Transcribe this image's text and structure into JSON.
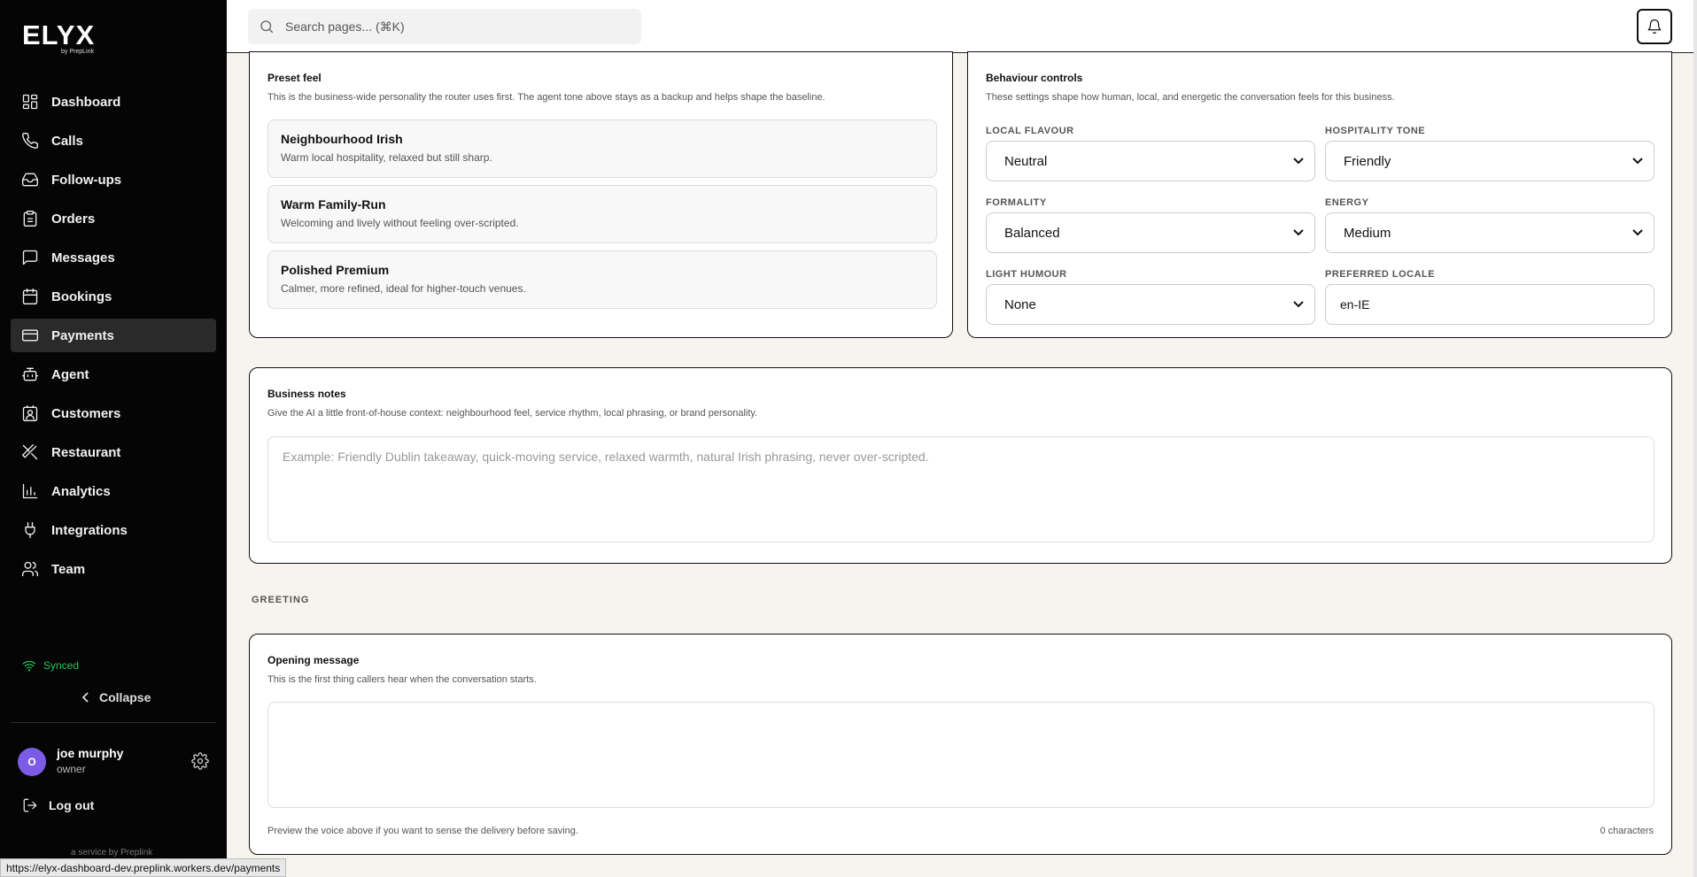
{
  "app": {
    "logo": "ELYX",
    "logo_sub": "by PrepLink"
  },
  "sidebar": {
    "items": [
      {
        "label": "Dashboard",
        "icon": "grid-icon"
      },
      {
        "label": "Calls",
        "icon": "phone-icon"
      },
      {
        "label": "Follow-ups",
        "icon": "inbox-icon"
      },
      {
        "label": "Orders",
        "icon": "clipboard-icon"
      },
      {
        "label": "Messages",
        "icon": "message-icon"
      },
      {
        "label": "Bookings",
        "icon": "calendar-icon"
      },
      {
        "label": "Payments",
        "icon": "card-icon",
        "active": true
      },
      {
        "label": "Agent",
        "icon": "bot-icon"
      },
      {
        "label": "Customers",
        "icon": "contact-icon"
      },
      {
        "label": "Restaurant",
        "icon": "utensils-icon"
      },
      {
        "label": "Analytics",
        "icon": "bar-chart-icon"
      },
      {
        "label": "Integrations",
        "icon": "plug-icon"
      },
      {
        "label": "Team",
        "icon": "users-icon"
      }
    ],
    "synced_label": "Synced",
    "collapse_label": "Collapse",
    "user": {
      "initial": "O",
      "name": "joe murphy",
      "role": "owner"
    },
    "logout_label": "Log out",
    "service_label": "a service by Preplink"
  },
  "topbar": {
    "search_placeholder": "Search pages... (⌘K)"
  },
  "preset_feel": {
    "title": "Preset feel",
    "description": "This is the business-wide personality the router uses first. The agent tone above stays as a backup and helps shape the baseline.",
    "options": [
      {
        "name": "Neighbourhood Irish",
        "desc": "Warm local hospitality, relaxed but still sharp."
      },
      {
        "name": "Warm Family-Run",
        "desc": "Welcoming and lively without feeling over-scripted."
      },
      {
        "name": "Polished Premium",
        "desc": "Calmer, more refined, ideal for higher-touch venues."
      }
    ]
  },
  "behaviour": {
    "title": "Behaviour controls",
    "description": "These settings shape how human, local, and energetic the conversation feels for this business.",
    "local_flavour": {
      "label": "LOCAL FLAVOUR",
      "value": "Neutral"
    },
    "hospitality_tone": {
      "label": "HOSPITALITY TONE",
      "value": "Friendly"
    },
    "formality": {
      "label": "FORMALITY",
      "value": "Balanced"
    },
    "energy": {
      "label": "ENERGY",
      "value": "Medium"
    },
    "light_humour": {
      "label": "LIGHT HUMOUR",
      "value": "None"
    },
    "preferred_locale": {
      "label": "PREFERRED LOCALE",
      "value": "en-IE"
    }
  },
  "business_notes": {
    "title": "Business notes",
    "description": "Give the AI a little front-of-house context: neighbourhood feel, service rhythm, local phrasing, or brand personality.",
    "placeholder": "Example: Friendly Dublin takeaway, quick-moving service, relaxed warmth, natural Irish phrasing, never over-scripted."
  },
  "greeting_section_label": "GREETING",
  "opening_message": {
    "title": "Opening message",
    "description": "This is the first thing callers hear when the conversation starts.",
    "value": "",
    "hint": "Preview the voice above if you want to sense the delivery before saving.",
    "char_count": "0 characters"
  },
  "status_url": "https://elyx-dashboard-dev.preplink.workers.dev/payments"
}
